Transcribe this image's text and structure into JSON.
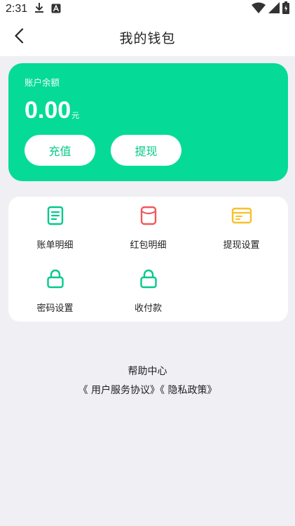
{
  "status_bar": {
    "time": "2:31",
    "left_icons": [
      "download-icon",
      "a-notification-icon"
    ],
    "right_icons": [
      "wifi-icon",
      "signal-icon",
      "battery-icon"
    ]
  },
  "nav": {
    "title": "我的钱包",
    "back_icon": "chevron-left-icon"
  },
  "balance": {
    "label": "账户余额",
    "amount": "0.00",
    "unit": "元",
    "recharge_label": "充值",
    "withdraw_label": "提现",
    "card_color": "#05db96"
  },
  "menu": {
    "items": [
      {
        "label": "账单明细",
        "icon": "bill-icon",
        "color": "#05c98a"
      },
      {
        "label": "红包明细",
        "icon": "red-packet-icon",
        "color": "#f0585c"
      },
      {
        "label": "提现设置",
        "icon": "card-icon",
        "color": "#f8c02c"
      },
      {
        "label": "密码设置",
        "icon": "lock-icon",
        "color": "#05c98a"
      },
      {
        "label": "收付款",
        "icon": "lock-icon",
        "color": "#05c98a"
      }
    ]
  },
  "footer": {
    "help_center": "帮助中心",
    "user_agreement": "《 用户服务协议》",
    "privacy_policy": "《 隐私政策》"
  }
}
